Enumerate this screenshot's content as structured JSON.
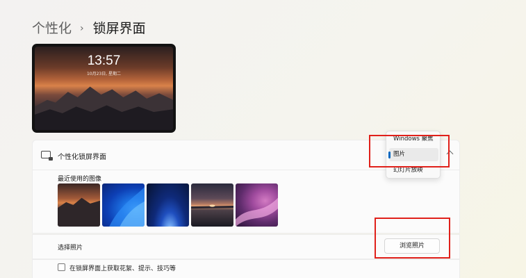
{
  "breadcrumb": {
    "parent": "个性化",
    "separator": "›",
    "current": "锁屏界面"
  },
  "preview": {
    "time": "13:57",
    "date": "10月23日, 星期二"
  },
  "personalize_row": {
    "label": "个性化锁屏界面",
    "icon": "lockscreen-icon"
  },
  "dropdown": {
    "options": [
      "Windows 聚焦",
      "图片",
      "幻灯片放映"
    ],
    "selected": "图片"
  },
  "recent": {
    "label": "最近使用的图像",
    "images": [
      "mountain-sunset",
      "blue-bloom",
      "blue-glow",
      "lake-sunset",
      "purple-ribbon"
    ]
  },
  "choose_photo": {
    "label": "选择照片",
    "button": "浏览照片"
  },
  "tips_checkbox": {
    "label": "在锁屏界面上获取花絮、提示、技巧等",
    "checked": false
  },
  "colors": {
    "accent": "#0067c0",
    "highlight": "#e0201a"
  }
}
